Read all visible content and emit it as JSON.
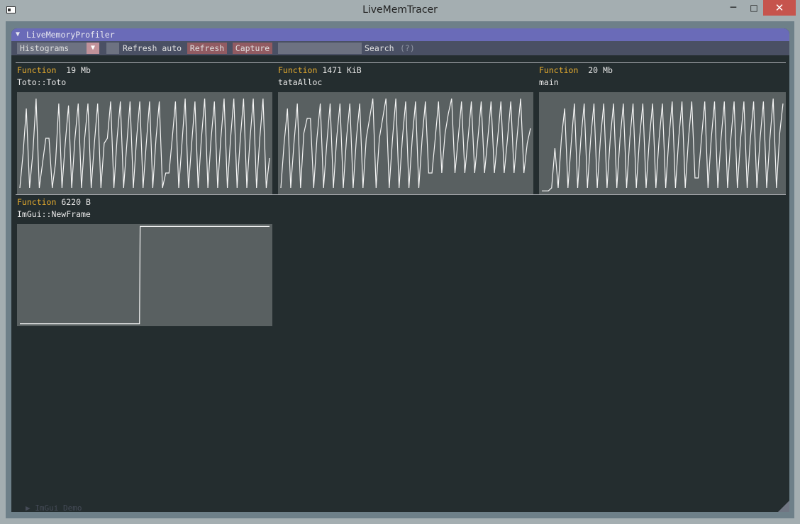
{
  "window": {
    "title": "LiveMemTracer",
    "minimize_glyph": "─",
    "maximize_glyph": "□",
    "close_glyph": "✕"
  },
  "profiler": {
    "title": "LiveMemoryProfiler",
    "collapse_arrow": "▼",
    "view_select": "Histograms",
    "view_select_arrow": "▼",
    "refresh_auto_label": "Refresh auto",
    "refresh_auto_checked": false,
    "refresh_button": "Refresh",
    "capture_button": "Capture",
    "search_value": "",
    "search_label": "Search",
    "search_help": "(?)"
  },
  "colors": {
    "function_label": "#e6ac2e",
    "title_bar": "#6a6bb8",
    "button": "#915b62",
    "plot_bg": "#596061",
    "plot_line": "#f5f5f5"
  },
  "histograms": [
    {
      "label": "Function",
      "size": "19 Mb",
      "name": "Toto::Toto",
      "chart_data": {
        "type": "line",
        "series": [
          {
            "values": [
              0.05,
              0.4,
              0.85,
              0.05,
              0.4,
              0.95,
              0.05,
              0.3,
              0.55,
              0.55,
              0.05,
              0.3,
              0.9,
              0.05,
              0.5,
              0.88,
              0.05,
              0.55,
              0.9,
              0.05,
              0.55,
              0.9,
              0.05,
              0.5,
              0.9,
              0.05,
              0.5,
              0.55,
              0.92,
              0.05,
              0.55,
              0.92,
              0.05,
              0.5,
              0.92,
              0.05,
              0.55,
              0.92,
              0.05,
              0.5,
              0.92,
              0.05,
              0.55,
              0.92,
              0.05,
              0.2,
              0.2,
              0.55,
              0.92,
              0.05,
              0.5,
              0.95,
              0.05,
              0.5,
              0.92,
              0.05,
              0.55,
              0.95,
              0.05,
              0.55,
              0.92,
              0.05,
              0.55,
              0.95,
              0.05,
              0.55,
              0.95,
              0.05,
              0.55,
              0.95,
              0.05,
              0.55,
              0.95,
              0.05,
              0.55,
              0.95,
              0.05,
              0.35
            ]
          }
        ],
        "ylim": [
          0,
          1
        ]
      }
    },
    {
      "label": "Function",
      "size": "1471 KiB",
      "name": "tataAlloc",
      "chart_data": {
        "type": "line",
        "series": [
          {
            "values": [
              0.05,
              0.5,
              0.85,
              0.05,
              0.5,
              0.9,
              0.05,
              0.6,
              0.75,
              0.75,
              0.05,
              0.55,
              0.9,
              0.05,
              0.5,
              0.9,
              0.05,
              0.55,
              0.9,
              0.05,
              0.55,
              0.9,
              0.05,
              0.55,
              0.9,
              0.05,
              0.55,
              0.75,
              0.95,
              0.05,
              0.55,
              0.75,
              0.95,
              0.05,
              0.55,
              0.95,
              0.05,
              0.55,
              0.92,
              0.05,
              0.55,
              0.92,
              0.05,
              0.55,
              0.92,
              0.2,
              0.2,
              0.55,
              0.92,
              0.2,
              0.6,
              0.8,
              0.95,
              0.2,
              0.55,
              0.92,
              0.2,
              0.55,
              0.92,
              0.2,
              0.55,
              0.92,
              0.2,
              0.55,
              0.92,
              0.2,
              0.55,
              0.92,
              0.2,
              0.55,
              0.92,
              0.2,
              0.6,
              0.95,
              0.2,
              0.5,
              0.65
            ]
          }
        ],
        "ylim": [
          0,
          1
        ]
      }
    },
    {
      "label": "Function",
      "size": "20 Mb",
      "name": "main",
      "chart_data": {
        "type": "line",
        "series": [
          {
            "values": [
              0.02,
              0.02,
              0.02,
              0.05,
              0.45,
              0.05,
              0.55,
              0.85,
              0.05,
              0.5,
              0.9,
              0.05,
              0.55,
              0.9,
              0.05,
              0.55,
              0.9,
              0.05,
              0.55,
              0.9,
              0.05,
              0.55,
              0.9,
              0.05,
              0.55,
              0.9,
              0.05,
              0.55,
              0.9,
              0.05,
              0.55,
              0.9,
              0.05,
              0.55,
              0.9,
              0.05,
              0.55,
              0.9,
              0.05,
              0.55,
              0.92,
              0.05,
              0.55,
              0.92,
              0.05,
              0.55,
              0.92,
              0.15,
              0.15,
              0.55,
              0.92,
              0.05,
              0.55,
              0.92,
              0.05,
              0.55,
              0.92,
              0.05,
              0.55,
              0.92,
              0.05,
              0.55,
              0.92,
              0.05,
              0.55,
              0.92,
              0.05,
              0.55,
              0.92,
              0.05,
              0.55,
              0.95,
              0.05,
              0.6,
              0.9
            ]
          }
        ],
        "ylim": [
          0,
          1
        ]
      }
    },
    {
      "label": "Function",
      "size": "6220 B",
      "name": "ImGui::NewFrame",
      "chart_data": {
        "type": "line",
        "series": [
          {
            "values": [
              0.01,
              0.01,
              0.01,
              0.01,
              0.01,
              0.01,
              0.01,
              0.01,
              0.01,
              0.01,
              0.01,
              0.01,
              0.01,
              0.01,
              0.01,
              0.01,
              0.01,
              0.01,
              0.01,
              0.01,
              0.01,
              0.01,
              0.01,
              0.01,
              0.01,
              0.01,
              0.01,
              0.01,
              0.01,
              0.01,
              0.01,
              0.01,
              0.01,
              0.01,
              0.01,
              0.01,
              0.01,
              0.01,
              0.01,
              0.01,
              0.01,
              0.01,
              0.01,
              0.01,
              0.01,
              0.01,
              0.01,
              0.01,
              0.01,
              0.01,
              0.01,
              0.01,
              0.01,
              0.01,
              0.01,
              0.01,
              0.01,
              0.01,
              0.01,
              0.01,
              0.01,
              0.01,
              0.01,
              0.01,
              0.01,
              0.01,
              0.01,
              0.01,
              0.01,
              0.01,
              0.01,
              0.01,
              0.01,
              0.01,
              0.01,
              0.01,
              0.01,
              0.01,
              0.01,
              0.01,
              0.01,
              0.01,
              0.01,
              0.01,
              0.01,
              0.01,
              0.01,
              0.01,
              0.01,
              0.01,
              0.01,
              0.01,
              0.01,
              0.01,
              0.01,
              0.01,
              0.01,
              0.01,
              0.01,
              0.01,
              0.01,
              0.01,
              0.01,
              0.01,
              0.01,
              0.01,
              0.01,
              0.01,
              0.01,
              0.01,
              0.01,
              0.01,
              0.01,
              0.01,
              0.01,
              0.01,
              0.01,
              0.01,
              0.01,
              0.01,
              0.01,
              0.01,
              0.01,
              0.01,
              0.01,
              0.01,
              0.01,
              0.01,
              0.01,
              0.01,
              0.01,
              0.01,
              0.01,
              0.01,
              0.01,
              0.01,
              0.01,
              0.01,
              0.01,
              0.01,
              0.01,
              0.01,
              0.01,
              0.01,
              0.01,
              0.01,
              0.01,
              0.01,
              0.01,
              0.01,
              0.01,
              0.01,
              0.01,
              0.01,
              0.01,
              0.01,
              0.01,
              0.01,
              0.01,
              0.01,
              0.01,
              0.01,
              0.01,
              0.01,
              0.01,
              0.01,
              0.01,
              0.01,
              0.01,
              0.01,
              0.01,
              0.01,
              0.01,
              0.01,
              0.01,
              0.01,
              0.01,
              0.01,
              0.01,
              0.01,
              0.01,
              0.01,
              0.01,
              0.01,
              0.01,
              0.01,
              0.01,
              0.01,
              0.01,
              0.01,
              0.01,
              0.01,
              0.01,
              0.01,
              0.01,
              0.01,
              0.01,
              0.01,
              0.99,
              0.99,
              0.99,
              0.99,
              0.99,
              0.99,
              0.99,
              0.99,
              0.99,
              0.99,
              0.99,
              0.99,
              0.99,
              0.99,
              0.99,
              0.99,
              0.99,
              0.99,
              0.99,
              0.99,
              0.99,
              0.99,
              0.99,
              0.99,
              0.99,
              0.99,
              0.99,
              0.99,
              0.99,
              0.99,
              0.99,
              0.99,
              0.99,
              0.99,
              0.99,
              0.99,
              0.99,
              0.99,
              0.99,
              0.99,
              0.99,
              0.99,
              0.99,
              0.99,
              0.99,
              0.99,
              0.99,
              0.99,
              0.99,
              0.99,
              0.99,
              0.99,
              0.99,
              0.99,
              0.99,
              0.99,
              0.99,
              0.99,
              0.99,
              0.99,
              0.99,
              0.99,
              0.99,
              0.99,
              0.99,
              0.99,
              0.99,
              0.99,
              0.99,
              0.99,
              0.99,
              0.99,
              0.99,
              0.99,
              0.99,
              0.99,
              0.99,
              0.99,
              0.99,
              0.99,
              0.99,
              0.99,
              0.99,
              0.99,
              0.99,
              0.99,
              0.99,
              0.99,
              0.99,
              0.99,
              0.99,
              0.99,
              0.99,
              0.99,
              0.99,
              0.99,
              0.99,
              0.99,
              0.99,
              0.99,
              0.99,
              0.99,
              0.99,
              0.99,
              0.99,
              0.99,
              0.99,
              0.99,
              0.99,
              0.99,
              0.99,
              0.99,
              0.99,
              0.99,
              0.99,
              0.99,
              0.99,
              0.99,
              0.99,
              0.99,
              0.99,
              0.99,
              0.99,
              0.99,
              0.99,
              0.99,
              0.99,
              0.99,
              0.99,
              0.99,
              0.99,
              0.99,
              0.99,
              0.99,
              0.99,
              0.99,
              0.99,
              0.99,
              0.99,
              0.99,
              0.99,
              0.99,
              0.99,
              0.99,
              0.99,
              0.99,
              0.99,
              0.99,
              0.99,
              0.99,
              0.99,
              0.99,
              0.99,
              0.99,
              0.99,
              0.99,
              0.99,
              0.99,
              0.99,
              0.99,
              0.99,
              0.99,
              0.99,
              0.99,
              0.99,
              0.99,
              0.99,
              0.99,
              0.99,
              0.99,
              0.99,
              0.99,
              0.99,
              0.99,
              0.99,
              0.99,
              0.99,
              0.99,
              0.99,
              0.99,
              0.99,
              0.99,
              0.99,
              0.99,
              0.99,
              0.99,
              0.99,
              0.99,
              0.99,
              0.99,
              0.99,
              0.99,
              0.99,
              0.99,
              0.99,
              0.99,
              0.99,
              0.99,
              0.99,
              0.99,
              0.99,
              0.99,
              0.99,
              0.99,
              0.99,
              0.99,
              0.99,
              0.99,
              0.99,
              0.99,
              0.99,
              0.99,
              0.99,
              0.99
            ]
          }
        ],
        "ylim": [
          0,
          1
        ]
      }
    }
  ],
  "collapsed_window": {
    "arrow": "▶",
    "title": "ImGui Demo"
  }
}
